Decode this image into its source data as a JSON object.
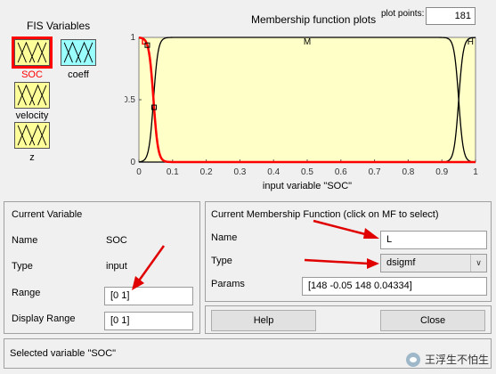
{
  "fis": {
    "title": "FIS Variables",
    "variables": [
      {
        "label": "SOC",
        "kind": "input",
        "selected": true
      },
      {
        "label": "coeff",
        "kind": "output",
        "selected": false
      },
      {
        "label": "velocity",
        "kind": "input",
        "selected": false
      },
      {
        "label": "z",
        "kind": "input",
        "selected": false
      }
    ]
  },
  "plot": {
    "title": "Membership function plots",
    "plot_points_label": "plot points:",
    "plot_points_value": "181",
    "xlabel": "input variable \"SOC\"",
    "mf_labels": [
      "L",
      "M",
      "H"
    ],
    "selected_mf": "L",
    "colors": {
      "background": "#ffffc8",
      "selected": "#ff0000",
      "normal": "#000000"
    }
  },
  "chart_data": {
    "type": "line",
    "title": "Membership function plots",
    "xlabel": "input variable \"SOC\"",
    "ylabel": "",
    "xlim": [
      0,
      1
    ],
    "ylim": [
      0,
      1
    ],
    "xticks": [
      "0",
      "0.1",
      "0.2",
      "0.3",
      "0.4",
      "0.5",
      "0.6",
      "0.7",
      "0.8",
      "0.9",
      "1"
    ],
    "yticks": [
      "0",
      "0.5",
      "1"
    ],
    "series": [
      {
        "name": "L",
        "mf": "dsigmf",
        "params": [
          148,
          -0.05,
          148,
          0.04334
        ],
        "selected": true
      },
      {
        "name": "M",
        "mf": "dsigmf",
        "params": [
          148,
          0.04334,
          148,
          0.95
        ],
        "selected": false
      },
      {
        "name": "H",
        "mf": "dsigmf",
        "params": [
          148,
          0.95,
          148,
          1.05
        ],
        "selected": false
      }
    ]
  },
  "current_variable": {
    "title": "Current Variable",
    "name_label": "Name",
    "name_value": "SOC",
    "type_label": "Type",
    "type_value": "input",
    "range_label": "Range",
    "range_value": "[0 1]",
    "display_range_label": "Display Range",
    "display_range_value": "[0 1]"
  },
  "current_mf": {
    "title": "Current Membership Function (click on MF to select)",
    "name_label": "Name",
    "name_value": "L",
    "type_label": "Type",
    "type_value": "dsigmf",
    "params_label": "Params",
    "params_value": "[148 -0.05 148 0.04334]"
  },
  "buttons": {
    "help": "Help",
    "close": "Close"
  },
  "status": "Selected variable \"SOC\"",
  "watermark": "王浮生不怕生"
}
